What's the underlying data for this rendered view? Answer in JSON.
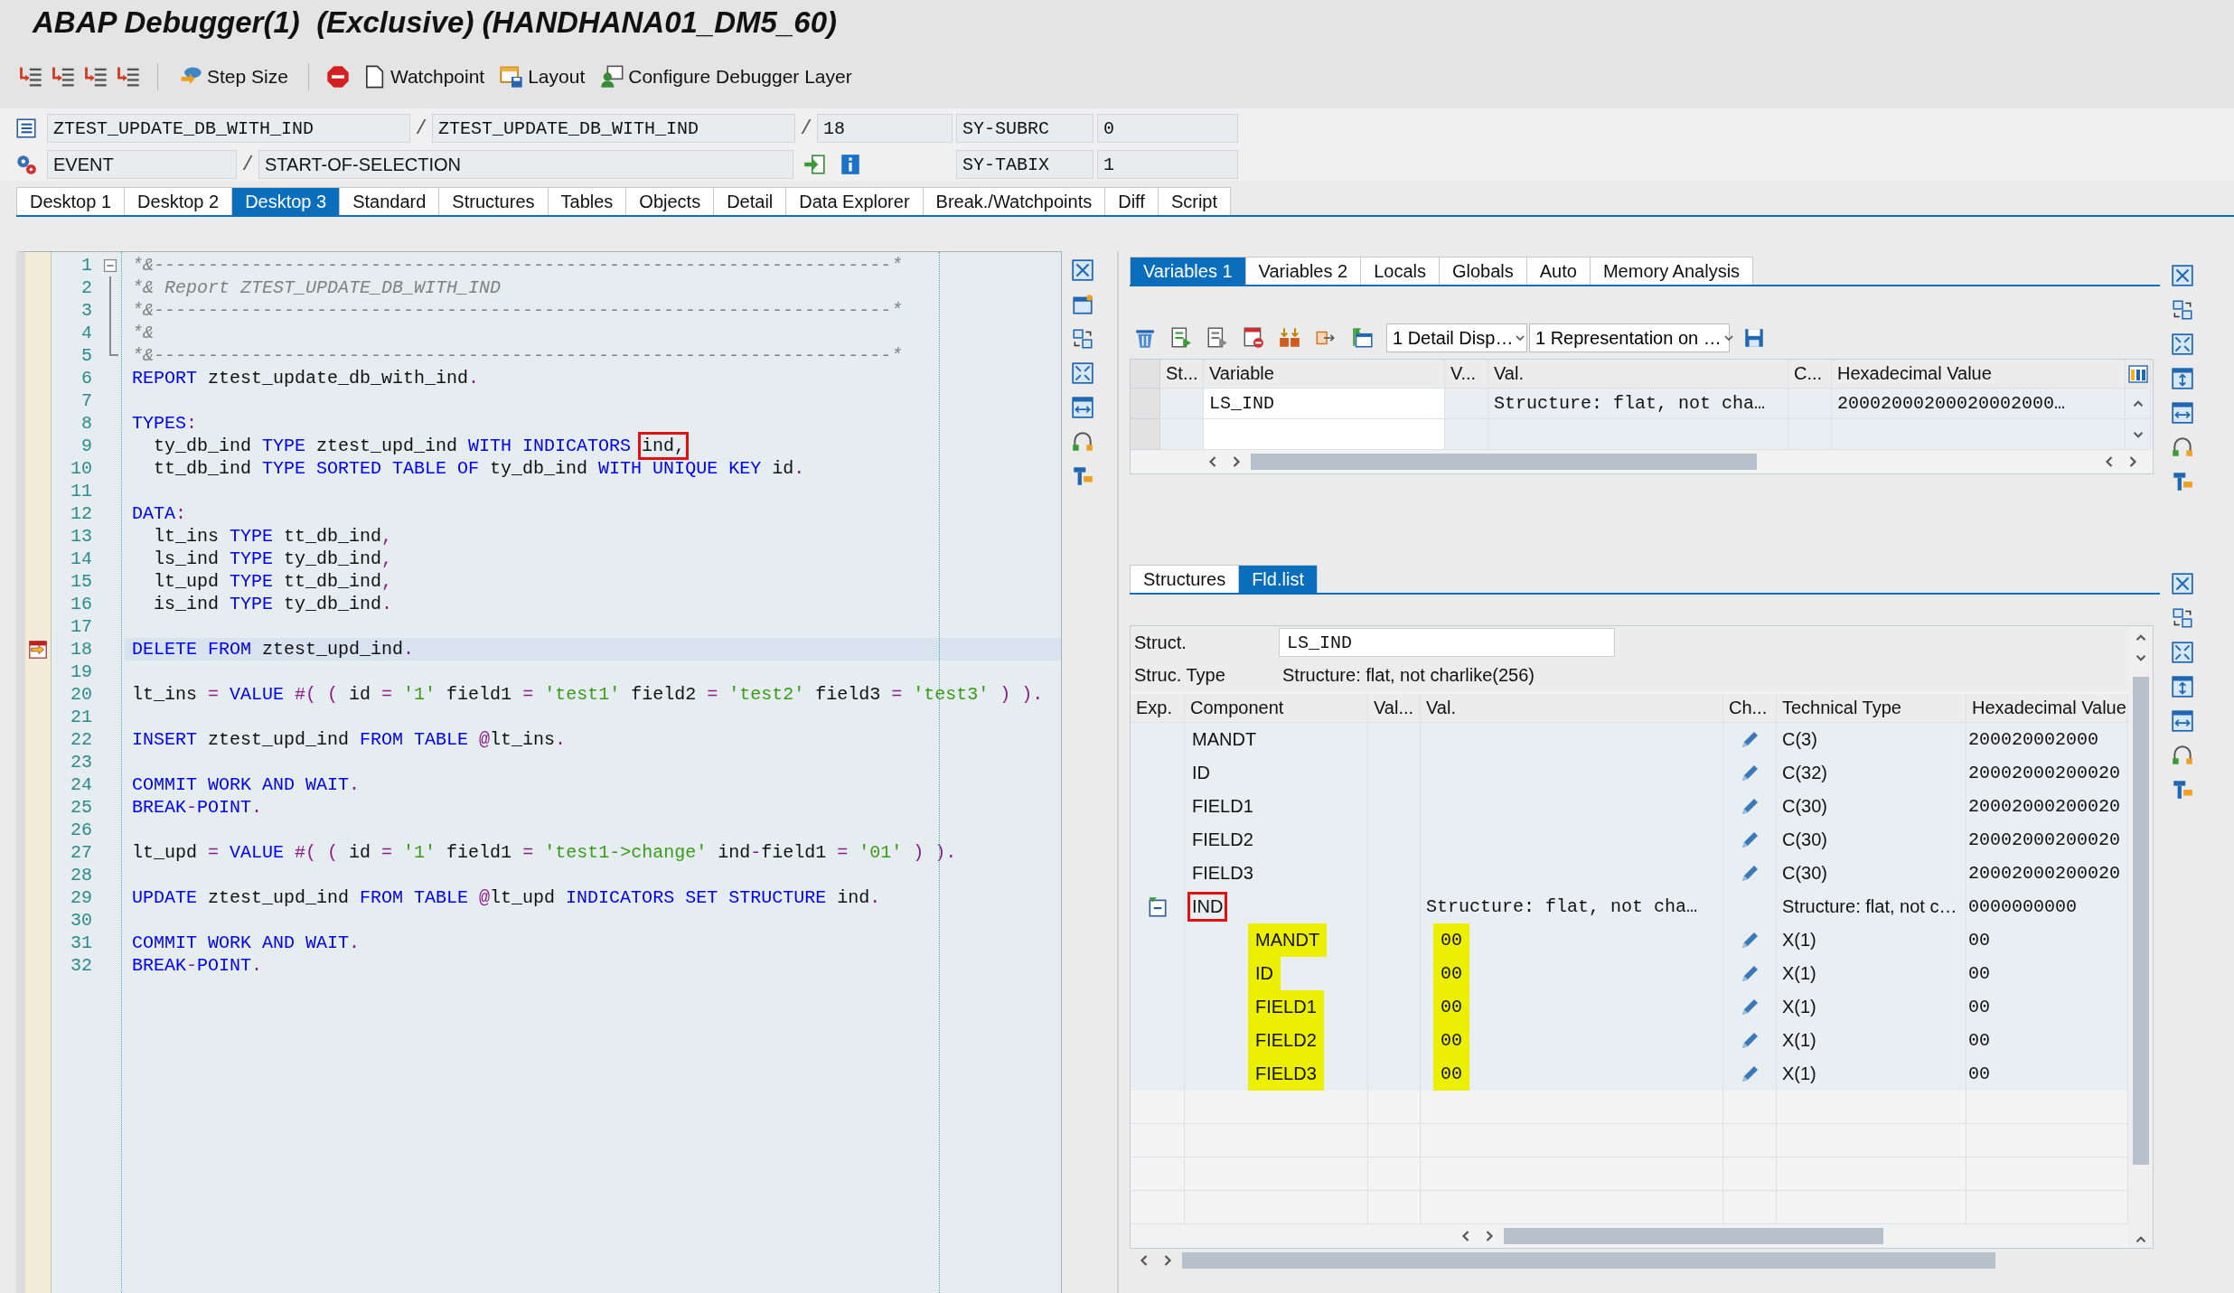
{
  "window": {
    "title": "ABAP Debugger(1)  (Exclusive) (HANDHANA01_DM5_60)"
  },
  "toolbar": {
    "buttons": [
      {
        "kind": "step_size",
        "label": "Step Size"
      },
      {
        "kind": "watchpoint",
        "label": "Watchpoint"
      },
      {
        "kind": "layout",
        "label": "Layout"
      },
      {
        "kind": "config",
        "label": "Configure Debugger Layer"
      }
    ]
  },
  "info": {
    "program": "ZTEST_UPDATE_DB_WITH_IND",
    "sep1": "/",
    "include": "ZTEST_UPDATE_DB_WITH_IND",
    "sep2": "/",
    "line": "18",
    "subrc_label": "SY-SUBRC",
    "subrc": "0",
    "event_type": "EVENT",
    "sep3": "/",
    "event": "START-OF-SELECTION",
    "tabix_label": "SY-TABIX",
    "tabix": "1"
  },
  "desktop_tabs": [
    {
      "label": "Desktop 1",
      "selected": false
    },
    {
      "label": "Desktop 2",
      "selected": false
    },
    {
      "label": "Desktop 3",
      "selected": true
    },
    {
      "label": "Standard",
      "selected": false
    },
    {
      "label": "Structures",
      "selected": false
    },
    {
      "label": "Tables",
      "selected": false
    },
    {
      "label": "Objects",
      "selected": false
    },
    {
      "label": "Detail",
      "selected": false
    },
    {
      "label": "Data Explorer",
      "selected": false
    },
    {
      "label": "Break./Watchpoints",
      "selected": false
    },
    {
      "label": "Diff",
      "selected": false
    },
    {
      "label": "Script",
      "selected": false
    }
  ],
  "code": {
    "lines": [
      {
        "n": "1",
        "kind": "fold_start",
        "current": false,
        "tokens": [
          {
            "kind": "cmt",
            "t": "*&--------------------------------------------------------------------*"
          }
        ]
      },
      {
        "n": "2",
        "kind": "fold_inner",
        "current": false,
        "tokens": [
          {
            "kind": "cmt",
            "t": "*& Report ZTEST_UPDATE_DB_WITH_IND"
          }
        ]
      },
      {
        "n": "3",
        "kind": "fold_inner",
        "current": false,
        "tokens": [
          {
            "kind": "cmt",
            "t": "*&--------------------------------------------------------------------*"
          }
        ]
      },
      {
        "n": "4",
        "kind": "fold_inner",
        "current": false,
        "tokens": [
          {
            "kind": "cmt",
            "t": "*&"
          }
        ]
      },
      {
        "n": "5",
        "kind": "fold_end",
        "current": false,
        "tokens": [
          {
            "kind": "cmt",
            "t": "*&--------------------------------------------------------------------*"
          }
        ]
      },
      {
        "n": "6",
        "kind": "code",
        "current": false,
        "tokens": [
          {
            "kind": "kw",
            "t": "REPORT"
          },
          {
            "kind": "id",
            "t": " ztest_update_db_with_ind"
          },
          {
            "kind": "op",
            "t": "."
          }
        ]
      },
      {
        "n": "7",
        "kind": "code",
        "current": false
      },
      {
        "n": "8",
        "kind": "code",
        "current": false,
        "tokens": [
          {
            "kind": "kw",
            "t": "TYPES"
          },
          {
            "kind": "op",
            "t": ":"
          }
        ]
      },
      {
        "n": "9",
        "kind": "code",
        "current": false,
        "tokens": [
          {
            "kind": "id",
            "t": "  ty_db_ind "
          },
          {
            "kind": "kw",
            "t": "TYPE"
          },
          {
            "kind": "id",
            "t": " ztest_upd_ind "
          },
          {
            "kind": "kw",
            "t": "WITH INDICATORS "
          },
          {
            "kind": "id",
            "t": "ind,",
            "boxed": true
          }
        ]
      },
      {
        "n": "10",
        "kind": "code",
        "current": false,
        "tokens": [
          {
            "kind": "id",
            "t": "  tt_db_ind "
          },
          {
            "kind": "kw",
            "t": "TYPE SORTED TABLE OF"
          },
          {
            "kind": "id",
            "t": " ty_db_ind "
          },
          {
            "kind": "kw",
            "t": "WITH UNIQUE KEY"
          },
          {
            "kind": "id",
            "t": " id"
          },
          {
            "kind": "op",
            "t": "."
          }
        ]
      },
      {
        "n": "11",
        "kind": "code",
        "current": false
      },
      {
        "n": "12",
        "kind": "code",
        "current": false,
        "tokens": [
          {
            "kind": "kw",
            "t": "DATA"
          },
          {
            "kind": "op",
            "t": ":"
          }
        ]
      },
      {
        "n": "13",
        "kind": "code",
        "current": false,
        "tokens": [
          {
            "kind": "id",
            "t": "  lt_ins "
          },
          {
            "kind": "kw",
            "t": "TYPE"
          },
          {
            "kind": "id",
            "t": " tt_db_ind"
          },
          {
            "kind": "op",
            "t": ","
          }
        ]
      },
      {
        "n": "14",
        "kind": "code",
        "current": false,
        "tokens": [
          {
            "kind": "id",
            "t": "  ls_ind "
          },
          {
            "kind": "kw",
            "t": "TYPE"
          },
          {
            "kind": "id",
            "t": " ty_db_ind"
          },
          {
            "kind": "op",
            "t": ","
          }
        ]
      },
      {
        "n": "15",
        "kind": "code",
        "current": false,
        "tokens": [
          {
            "kind": "id",
            "t": "  lt_upd "
          },
          {
            "kind": "kw",
            "t": "TYPE"
          },
          {
            "kind": "id",
            "t": " tt_db_ind"
          },
          {
            "kind": "op",
            "t": ","
          }
        ]
      },
      {
        "n": "16",
        "kind": "code",
        "current": false,
        "tokens": [
          {
            "kind": "id",
            "t": "  is_ind "
          },
          {
            "kind": "kw",
            "t": "TYPE"
          },
          {
            "kind": "id",
            "t": " ty_db_ind"
          },
          {
            "kind": "op",
            "t": "."
          }
        ]
      },
      {
        "n": "17",
        "kind": "code",
        "current": false
      },
      {
        "n": "18",
        "kind": "code",
        "current": true,
        "tokens": [
          {
            "kind": "kw",
            "t": "DELETE FROM"
          },
          {
            "kind": "id",
            "t": " ztest_upd_ind"
          },
          {
            "kind": "op",
            "t": "."
          }
        ]
      },
      {
        "n": "19",
        "kind": "code",
        "current": false
      },
      {
        "n": "20",
        "kind": "code",
        "current": false,
        "tokens": [
          {
            "kind": "id",
            "t": "lt_ins "
          },
          {
            "kind": "op",
            "t": "= "
          },
          {
            "kind": "kw",
            "t": "VALUE"
          },
          {
            "kind": "op",
            "t": " #( ( "
          },
          {
            "kind": "id",
            "t": "id "
          },
          {
            "kind": "op",
            "t": "= "
          },
          {
            "kind": "str",
            "t": "'1'"
          },
          {
            "kind": "id",
            "t": " field1 "
          },
          {
            "kind": "op",
            "t": "= "
          },
          {
            "kind": "str",
            "t": "'test1'"
          },
          {
            "kind": "id",
            "t": " field2 "
          },
          {
            "kind": "op",
            "t": "= "
          },
          {
            "kind": "str",
            "t": "'test2'"
          },
          {
            "kind": "id",
            "t": " field3 "
          },
          {
            "kind": "op",
            "t": "= "
          },
          {
            "kind": "str",
            "t": "'test3'"
          },
          {
            "kind": "op",
            "t": " ) )."
          }
        ]
      },
      {
        "n": "21",
        "kind": "code",
        "current": false
      },
      {
        "n": "22",
        "kind": "code",
        "current": false,
        "tokens": [
          {
            "kind": "kw",
            "t": "INSERT"
          },
          {
            "kind": "id",
            "t": " ztest_upd_ind "
          },
          {
            "kind": "kw",
            "t": "FROM TABLE"
          },
          {
            "kind": "op",
            "t": " @"
          },
          {
            "kind": "id",
            "t": "lt_ins"
          },
          {
            "kind": "op",
            "t": "."
          }
        ]
      },
      {
        "n": "23",
        "kind": "code",
        "current": false
      },
      {
        "n": "24",
        "kind": "code",
        "current": false,
        "tokens": [
          {
            "kind": "kw",
            "t": "COMMIT WORK AND WAIT"
          },
          {
            "kind": "op",
            "t": "."
          }
        ]
      },
      {
        "n": "25",
        "kind": "code",
        "current": false,
        "tokens": [
          {
            "kind": "kw",
            "t": "BREAK"
          },
          {
            "kind": "op",
            "t": "-"
          },
          {
            "kind": "kw",
            "t": "POINT"
          },
          {
            "kind": "op",
            "t": "."
          }
        ]
      },
      {
        "n": "26",
        "kind": "code",
        "current": false
      },
      {
        "n": "27",
        "kind": "code",
        "current": false,
        "tokens": [
          {
            "kind": "id",
            "t": "lt_upd "
          },
          {
            "kind": "op",
            "t": "= "
          },
          {
            "kind": "kw",
            "t": "VALUE"
          },
          {
            "kind": "op",
            "t": " #( ( "
          },
          {
            "kind": "id",
            "t": "id "
          },
          {
            "kind": "op",
            "t": "= "
          },
          {
            "kind": "str",
            "t": "'1'"
          },
          {
            "kind": "id",
            "t": " field1 "
          },
          {
            "kind": "op",
            "t": "= "
          },
          {
            "kind": "str",
            "t": "'test1->change'"
          },
          {
            "kind": "id",
            "t": " ind"
          },
          {
            "kind": "op",
            "t": "-"
          },
          {
            "kind": "id",
            "t": "field1 "
          },
          {
            "kind": "op",
            "t": "= "
          },
          {
            "kind": "str",
            "t": "'01'"
          },
          {
            "kind": "op",
            "t": " ) )."
          }
        ]
      },
      {
        "n": "28",
        "kind": "code",
        "current": false
      },
      {
        "n": "29",
        "kind": "code",
        "current": false,
        "tokens": [
          {
            "kind": "kw",
            "t": "UPDATE"
          },
          {
            "kind": "id",
            "t": " ztest_upd_ind "
          },
          {
            "kind": "kw",
            "t": "FROM TABLE"
          },
          {
            "kind": "op",
            "t": " @"
          },
          {
            "kind": "id",
            "t": "lt_upd "
          },
          {
            "kind": "kw",
            "t": "INDICATORS SET STRUCTURE"
          },
          {
            "kind": "id",
            "t": " ind"
          },
          {
            "kind": "op",
            "t": "."
          }
        ]
      },
      {
        "n": "30",
        "kind": "code",
        "current": false
      },
      {
        "n": "31",
        "kind": "code",
        "current": false,
        "tokens": [
          {
            "kind": "kw",
            "t": "COMMIT WORK AND WAIT"
          },
          {
            "kind": "op",
            "t": "."
          }
        ]
      },
      {
        "n": "32",
        "kind": "code",
        "current": false,
        "tokens": [
          {
            "kind": "kw",
            "t": "BREAK"
          },
          {
            "kind": "op",
            "t": "-"
          },
          {
            "kind": "kw",
            "t": "POINT"
          },
          {
            "kind": "op",
            "t": "."
          }
        ]
      }
    ]
  },
  "variables": {
    "tabs": [
      {
        "label": "Variables 1",
        "selected": true
      },
      {
        "label": "Variables 2",
        "selected": false
      },
      {
        "label": "Locals",
        "selected": false
      },
      {
        "label": "Globals",
        "selected": false
      },
      {
        "label": "Auto",
        "selected": false
      },
      {
        "label": "Memory Analysis",
        "selected": false
      }
    ],
    "detail_dropdown": "1 Detail Disp…",
    "representation_dropdown": "1 Representation on …",
    "columns": [
      "St...",
      "Variable",
      "V...",
      "Val.",
      "C...",
      "Hexadecimal Value"
    ],
    "rows": [
      {
        "variable": "LS_IND",
        "val": "Structure: flat, not cha…",
        "hex": "20002000200020002000…"
      }
    ]
  },
  "structure": {
    "tabs": [
      {
        "label": "Structures",
        "selected": false
      },
      {
        "label": "Fld.list",
        "selected": true
      }
    ],
    "struct_label": "Struct.",
    "struct_value": "LS_IND",
    "type_label": "Struc. Type",
    "type_value": "Structure: flat, not charlike(256)",
    "columns": [
      "Exp.",
      "Component",
      "Val...",
      "Val.",
      "Ch...",
      "Technical Type",
      "Hexadecimal Value"
    ],
    "rows": [
      {
        "component": "MANDT",
        "changeable": true,
        "tech": "C(3)",
        "hex": "200020002000",
        "highlighted": false
      },
      {
        "component": "ID",
        "changeable": true,
        "tech": "C(32)",
        "hex": "20002000200020",
        "highlighted": false
      },
      {
        "component": "FIELD1",
        "changeable": true,
        "tech": "C(30)",
        "hex": "20002000200020",
        "highlighted": false
      },
      {
        "component": "FIELD2",
        "changeable": true,
        "tech": "C(30)",
        "hex": "20002000200020",
        "highlighted": false
      },
      {
        "component": "FIELD3",
        "changeable": true,
        "tech": "C(30)",
        "hex": "20002000200020",
        "highlighted": false
      },
      {
        "component": "IND",
        "boxed": true,
        "expanded": true,
        "changeable": false,
        "val": "Structure: flat, not cha…",
        "tech": "Structure: flat, not c…",
        "hex": "0000000000",
        "highlighted": false,
        "children": [
          {
            "component": "MANDT",
            "val": "00",
            "changeable": true,
            "tech": "X(1)",
            "hex": "00",
            "highlighted": true
          },
          {
            "component": "ID",
            "val": "00",
            "changeable": true,
            "tech": "X(1)",
            "hex": "00",
            "highlighted": true
          },
          {
            "component": "FIELD1",
            "val": "00",
            "changeable": true,
            "tech": "X(1)",
            "hex": "00",
            "highlighted": true
          },
          {
            "component": "FIELD2",
            "val": "00",
            "changeable": true,
            "tech": "X(1)",
            "hex": "00",
            "highlighted": true
          },
          {
            "component": "FIELD3",
            "val": "00",
            "changeable": true,
            "tech": "X(1)",
            "hex": "00",
            "highlighted": true
          }
        ]
      }
    ]
  }
}
